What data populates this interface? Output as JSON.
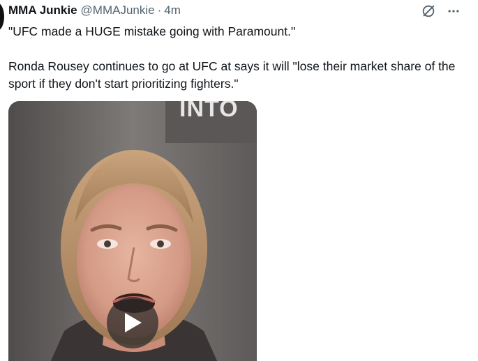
{
  "tweet": {
    "author_name": "MMA Junkie",
    "author_handle": "@MMAJunkie",
    "separator": "·",
    "time": "4m",
    "text": "\"UFC made a HUGE mistake going with Paramount.\"\n\nRonda Rousey continues to go at UFC at says it will \"lose their market share of the sport if they don't start prioritizing fighters.\"",
    "media": {
      "type": "video",
      "background_sign_text": "INTO"
    }
  },
  "icons": {
    "grok": "grok-icon",
    "more": "more-icon",
    "play": "play-icon"
  },
  "colors": {
    "text_primary": "#0f1419",
    "text_secondary": "#536471",
    "background": "#ffffff"
  }
}
